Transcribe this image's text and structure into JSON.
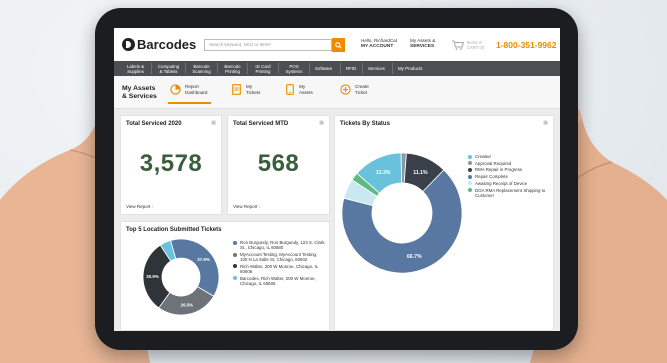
{
  "header": {
    "logo": "Barcodes",
    "search_placeholder": "Search keyword, SKU or Item#",
    "greeting": "Hello, RichardCat",
    "my_account": "MY ACCOUNT",
    "my_assets_line1": "My Assets &",
    "my_assets_line2": "SERVICES",
    "cart_line1": "Items In",
    "cart_line2": "CART (0)",
    "phone": "1-800-351-9962"
  },
  "nav": {
    "items": [
      "Labels & Supplies",
      "Computing & Tablets",
      "Barcode Scanning",
      "Barcode Printing",
      "ID Card Printing",
      "POS Systems",
      "Software",
      "RFID",
      "Services",
      "My Products"
    ]
  },
  "subheader": {
    "title_line1": "My Assets",
    "title_line2": "& Services",
    "tabs": [
      {
        "line1": "Report",
        "line2": "Dashboard",
        "icon": "pie-chart-icon"
      },
      {
        "line1": "My",
        "line2": "Tickets",
        "icon": "document-icon"
      },
      {
        "line1": "My",
        "line2": "Assets",
        "icon": "device-icon"
      },
      {
        "line1": "Create",
        "line2": "Ticket",
        "icon": "plus-circle-icon"
      }
    ]
  },
  "cards": {
    "serviced_2020": {
      "title": "Total Serviced 2020",
      "value": "3,578",
      "link": "View Report"
    },
    "serviced_mtd": {
      "title": "Total Serviced MTD",
      "value": "568",
      "link": "View Report"
    },
    "by_status": {
      "title": "Tickets By Status"
    },
    "top5": {
      "title": "Top 5 Location Submitted Tickets"
    }
  },
  "colors": {
    "accent": "#f08a00",
    "nav": "#4b4e52",
    "big_number": "#3a5e3c"
  },
  "chart_data": [
    {
      "type": "pie",
      "title": "Tickets By Status",
      "labels": [
        "Created",
        "Approval Required",
        "RMA Repair in Progress",
        "Repair Complete",
        "Awaiting Receipt of Device",
        "DOA RMA Replacement Shipping to Customer"
      ],
      "values": [
        13.3,
        1.4,
        11.1,
        66.7,
        5.4,
        2.1
      ],
      "data_labels": [
        "13.3%",
        "",
        "11.1%",
        "66.7%",
        "",
        ""
      ],
      "colors": [
        "#69c2dc",
        "#8b96a6",
        "#3a4049",
        "#5878a2",
        "#c9e8f2",
        "#5dbb82"
      ]
    },
    {
      "type": "pie",
      "title": "Top 5 Location Submitted Tickets",
      "labels": [
        "Ron Burgundy, Ron Burgundy, 123 S. Clark St., Chicago, IL 60680",
        "MyAccount Testing, MyAccount Testing, 100 N La Salle St, Chicago, 60602",
        "Rich Walter, 200 W Monroe, Chicago, IL 60606",
        "Barcodes, Rich Walter, 200 W Monroe, Chicago, IL 60606"
      ],
      "values": [
        37.9,
        26.5,
        30.9,
        4.7
      ],
      "data_labels": [
        "37.9%",
        "26.5%",
        "30.9%",
        ""
      ],
      "colors": [
        "#5878a2",
        "#6e7379",
        "#2f343a",
        "#69c2dc"
      ]
    }
  ]
}
